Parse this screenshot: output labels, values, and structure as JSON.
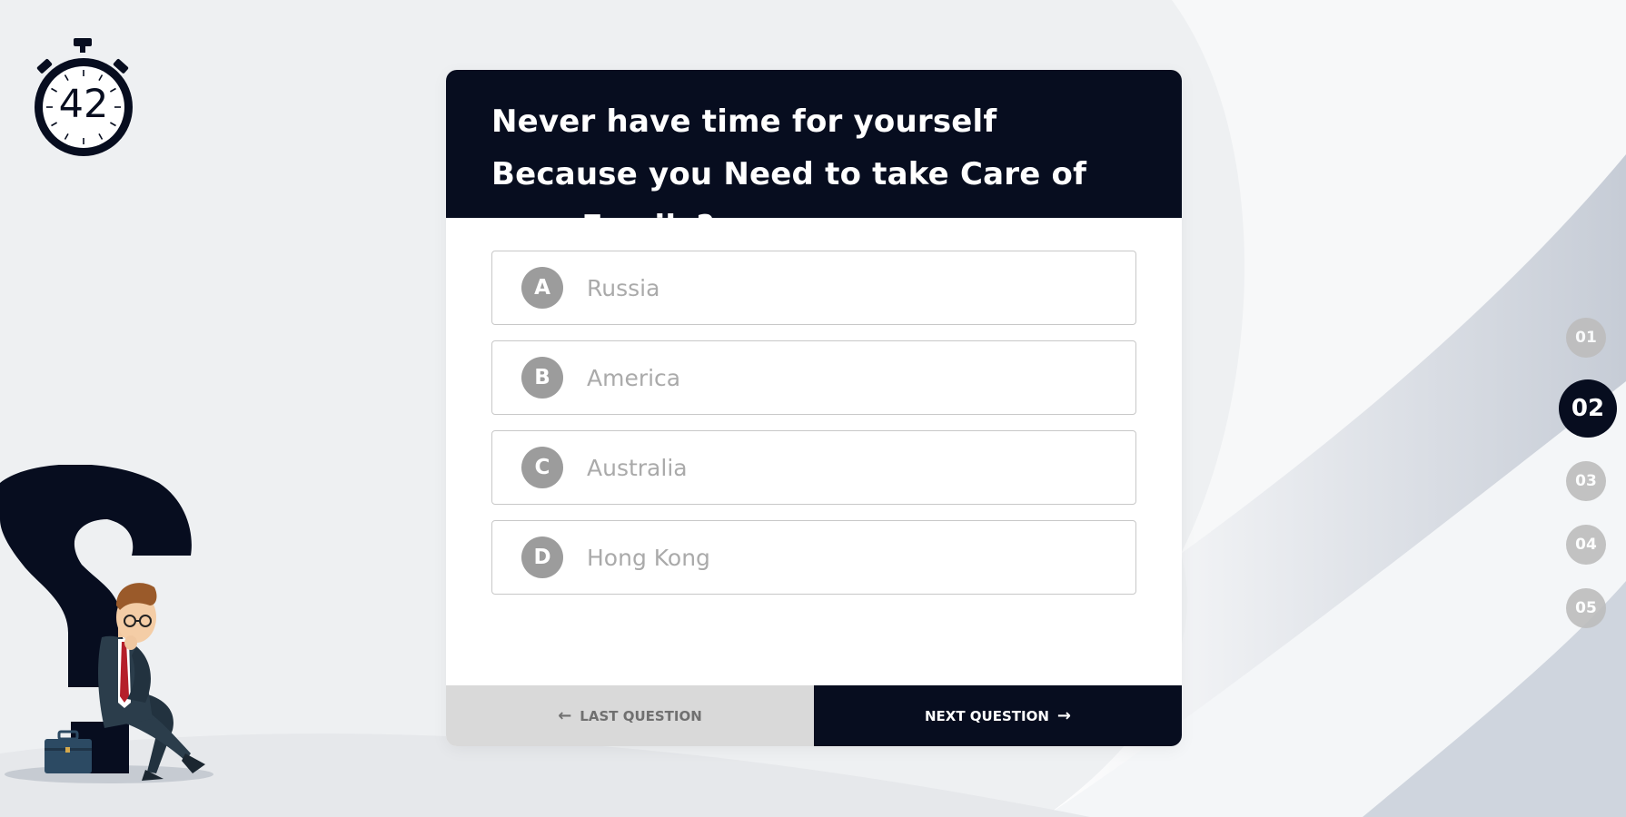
{
  "timer": {
    "seconds": "42"
  },
  "question": {
    "text": "Never have time for yourself Because you Need to take Care of your Family?"
  },
  "options": [
    {
      "letter": "A",
      "label": "Russia"
    },
    {
      "letter": "B",
      "label": "America"
    },
    {
      "letter": "C",
      "label": "Australia"
    },
    {
      "letter": "D",
      "label": "Hong Kong"
    }
  ],
  "nav": {
    "prev_label": "Last Question",
    "next_label": "Next Question"
  },
  "steps": [
    {
      "label": "01",
      "active": false
    },
    {
      "label": "02",
      "active": true
    },
    {
      "label": "03",
      "active": false
    },
    {
      "label": "04",
      "active": false
    },
    {
      "label": "05",
      "active": false
    }
  ],
  "colors": {
    "primary": "#070d1f",
    "option_circle": "#9c9c9c",
    "option_text": "#aaaaaa",
    "inactive_step": "#bdbdbd",
    "prev_button_bg": "#d9d9d9"
  }
}
